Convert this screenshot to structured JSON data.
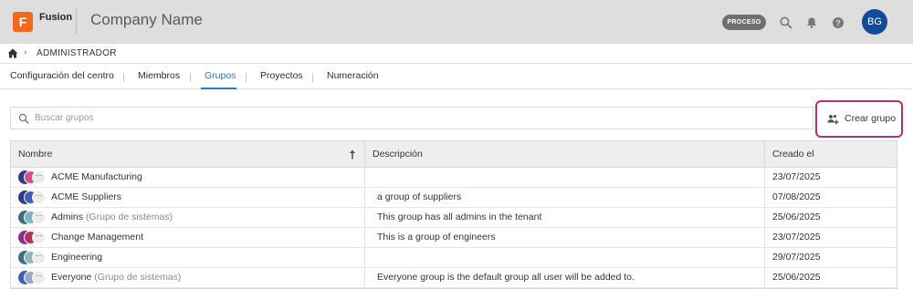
{
  "app": {
    "logo_letter": "F",
    "logo_text": "Fusion",
    "company_name": "Company Name",
    "status_badge": "PROCESO",
    "user_initials": "BG"
  },
  "breadcrumb": {
    "label": "ADMINISTRADOR",
    "separator": "›"
  },
  "tabs": [
    {
      "label": "Configuración del centro",
      "active": false
    },
    {
      "label": "Miembros",
      "active": false
    },
    {
      "label": "Grupos",
      "active": true
    },
    {
      "label": "Proyectos",
      "active": false
    },
    {
      "label": "Numeración",
      "active": false
    }
  ],
  "search": {
    "placeholder": "Buscar grupos",
    "value": ""
  },
  "create_button": {
    "label": "Crear grupo"
  },
  "table": {
    "columns": [
      "Nombre",
      "Descripción",
      "Creado el"
    ],
    "rows": [
      {
        "name": "ACME Manufacturing",
        "system_tag": "",
        "description": "",
        "created": "23/07/2025",
        "icon_colors": [
          "#2a3a8c",
          "#d64d8a"
        ]
      },
      {
        "name": "ACME Suppliers",
        "system_tag": "",
        "description": "a group of suppliers",
        "created": "07/08/2025",
        "icon_colors": [
          "#2a3a8c",
          "#3e5fb8"
        ]
      },
      {
        "name": "Admins",
        "system_tag": "(Grupo de sistemas)",
        "description": "This group has all admins in the tenant",
        "created": "25/06/2025",
        "icon_colors": [
          "#3b6f7f",
          "#7fb2c2"
        ]
      },
      {
        "name": "Change Management",
        "system_tag": "",
        "description": "This is a group of engineers",
        "created": "23/07/2025",
        "icon_colors": [
          "#8a2c8c",
          "#b03060"
        ]
      },
      {
        "name": "Engineering",
        "system_tag": "",
        "description": "",
        "created": "29/07/2025",
        "icon_colors": [
          "#3b6f7f",
          "#8fb7c4"
        ]
      },
      {
        "name": "Everyone",
        "system_tag": "(Grupo de sistemas)",
        "description": "Everyone group is the default group all user will be added to.",
        "created": "25/06/2025",
        "icon_colors": [
          "#3e5fb8",
          "#9aa8c8"
        ]
      }
    ]
  },
  "colors": {
    "accent": "#2a7aba",
    "highlight_border": "#b0307a",
    "logo": "#f26b1d",
    "avatar": "#124b99"
  }
}
